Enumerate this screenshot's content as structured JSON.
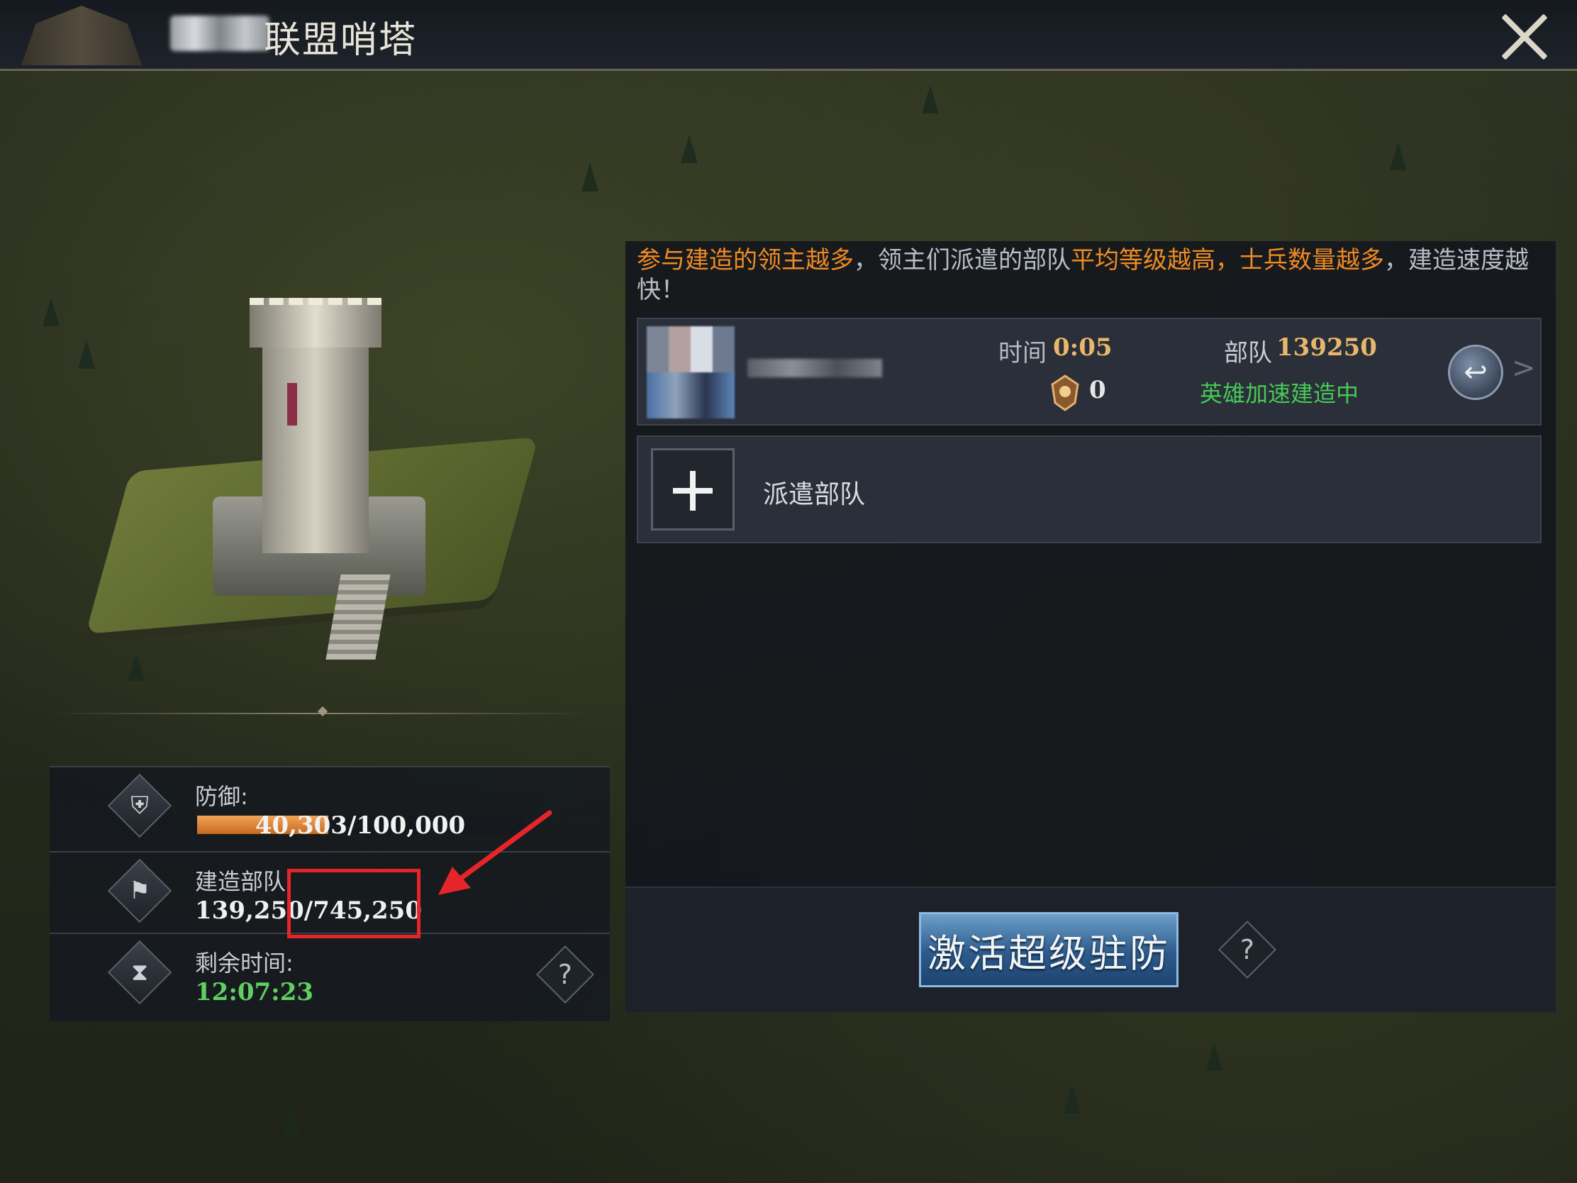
{
  "header": {
    "title": "联盟哨塔"
  },
  "stats": {
    "defense_label": "防御:",
    "defense_value": "40,303/100,000",
    "defense_progress": 0.403,
    "build_label": "建造部队",
    "build_value": "139,250/745,250",
    "time_label": "剩余时间:",
    "time_value": "12:07:23",
    "help_glyph": "?"
  },
  "panel": {
    "notice_part1": "参与建造的领主越多",
    "notice_part2": "，领主们派遣的部队",
    "notice_part3": "平均等级越高，士兵数量越多",
    "notice_part4": "，建造速度越快！",
    "entry": {
      "time_label": "时间",
      "time_value": "0:05",
      "medal_value": "0",
      "troop_label": "部队",
      "troop_value": "139250",
      "status": "英雄加速建造中",
      "chevron": ">"
    },
    "dispatch_label": "派遣部队",
    "activate_label": "激活超级驻防",
    "help_glyph": "?"
  },
  "colors": {
    "highlight": "#f08a24",
    "green": "#47c956",
    "annotation": "#e5252a"
  }
}
